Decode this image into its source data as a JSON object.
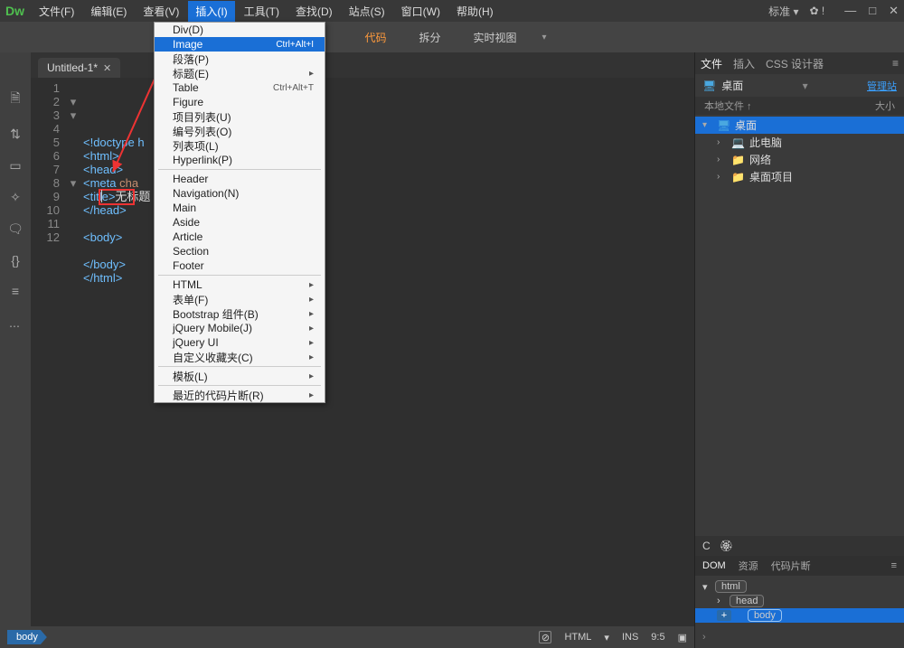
{
  "app": {
    "logo": "Dw"
  },
  "menubar": [
    "文件(F)",
    "编辑(E)",
    "查看(V)",
    "插入(I)",
    "工具(T)",
    "查找(D)",
    "站点(S)",
    "窗口(W)",
    "帮助(H)"
  ],
  "menubar_open_index": 3,
  "titlebar_right": {
    "mode": "标准 ▾",
    "gear": "✿ !"
  },
  "win_controls": [
    "—",
    "□",
    "✕"
  ],
  "view_tabs": {
    "items": [
      "代码",
      "拆分",
      "实时视图"
    ],
    "active_index": 0
  },
  "dropdown": {
    "groups": [
      [
        {
          "label": "Div(D)",
          "shortcut": ""
        },
        {
          "label": "Image",
          "shortcut": "Ctrl+Alt+I",
          "highlight": true
        },
        {
          "label": "段落(P)",
          "shortcut": ""
        },
        {
          "label": "标题(E)",
          "shortcut": "",
          "sub": true
        },
        {
          "label": "Table",
          "shortcut": "Ctrl+Alt+T"
        },
        {
          "label": "Figure",
          "shortcut": ""
        },
        {
          "label": "项目列表(U)",
          "shortcut": ""
        },
        {
          "label": "编号列表(O)",
          "shortcut": ""
        },
        {
          "label": "列表项(L)",
          "shortcut": ""
        },
        {
          "label": "Hyperlink(P)",
          "shortcut": ""
        }
      ],
      [
        {
          "label": "Header"
        },
        {
          "label": "Navigation(N)"
        },
        {
          "label": "Main"
        },
        {
          "label": "Aside"
        },
        {
          "label": "Article"
        },
        {
          "label": "Section"
        },
        {
          "label": "Footer"
        }
      ],
      [
        {
          "label": "HTML",
          "sub": true
        },
        {
          "label": "表单(F)",
          "sub": true
        },
        {
          "label": "Bootstrap 组件(B)",
          "sub": true
        },
        {
          "label": "jQuery Mobile(J)",
          "sub": true
        },
        {
          "label": "jQuery UI",
          "sub": true
        },
        {
          "label": "自定义收藏夹(C)",
          "sub": true
        }
      ],
      [
        {
          "label": "模板(L)",
          "sub": true
        }
      ],
      [
        {
          "label": "最近的代码片断(R)",
          "sub": true
        }
      ]
    ]
  },
  "tab": {
    "title": "Untitled-1*"
  },
  "code": {
    "lines": [
      {
        "n": 1,
        "fold": "",
        "html": "<span class='c-doctype'>&lt;!doctype h</span>"
      },
      {
        "n": 2,
        "fold": "▾",
        "html": "<span class='c-tag'>&lt;html&gt;</span>"
      },
      {
        "n": 3,
        "fold": "▾",
        "html": "<span class='c-tag'>&lt;head&gt;</span>"
      },
      {
        "n": 4,
        "fold": "",
        "html": "<span class='c-tag'>&lt;meta</span> <span class='c-attr'>cha</span>"
      },
      {
        "n": 5,
        "fold": "",
        "html": "<span class='c-tag'>&lt;title&gt;</span><span class='c-text'>无标题</span>"
      },
      {
        "n": 6,
        "fold": "",
        "html": "<span class='c-tag'>&lt;/head&gt;</span>"
      },
      {
        "n": 7,
        "fold": "",
        "html": ""
      },
      {
        "n": 8,
        "fold": "▾",
        "html": "<span class='c-tag'>&lt;body&gt;</span>"
      },
      {
        "n": 9,
        "fold": "",
        "html": ""
      },
      {
        "n": 10,
        "fold": "",
        "html": "<span class='c-tag'>&lt;/body&gt;</span>"
      },
      {
        "n": 11,
        "fold": "",
        "html": "<span class='c-tag'>&lt;/html&gt;</span>"
      },
      {
        "n": 12,
        "fold": "",
        "html": ""
      }
    ]
  },
  "right_panel": {
    "tabs": [
      "文件",
      "插入",
      "CSS 设计器"
    ],
    "desktop_label": "桌面",
    "manage_link": "管理站",
    "sub_left": "本地文件 ↑",
    "sub_right": "大小",
    "tree": [
      {
        "indent": 0,
        "arrow": "▾",
        "ico": "🖥",
        "label": "桌面",
        "sel": true,
        "cls": "monitor-ico"
      },
      {
        "indent": 1,
        "arrow": "›",
        "ico": "💻",
        "label": "此电脑",
        "cls": "monitor-ico"
      },
      {
        "indent": 1,
        "arrow": "›",
        "ico": "📁",
        "label": "网络",
        "cls": "folder-ico"
      },
      {
        "indent": 1,
        "arrow": "›",
        "ico": "📁",
        "label": "桌面项目",
        "cls": "folder-ico"
      }
    ],
    "refresh_icons": [
      "C",
      "🏵"
    ]
  },
  "dom_panel": {
    "tabs": [
      "DOM",
      "资源",
      "代码片断"
    ],
    "rows": [
      {
        "indent": 0,
        "arrow": "▾",
        "tag": "html",
        "sel": false,
        "plus": false
      },
      {
        "indent": 1,
        "arrow": "›",
        "tag": "head",
        "sel": false,
        "plus": false
      },
      {
        "indent": 1,
        "arrow": "",
        "tag": "body",
        "sel": true,
        "plus": true
      }
    ]
  },
  "statusbar": {
    "crumb": "body",
    "right": {
      "err": "⊘",
      "lang": "HTML",
      "lang_caret": "▾",
      "ins": "INS",
      "pos": "9:5",
      "overlay": "▣"
    }
  },
  "right_status": {
    "text": "›"
  }
}
